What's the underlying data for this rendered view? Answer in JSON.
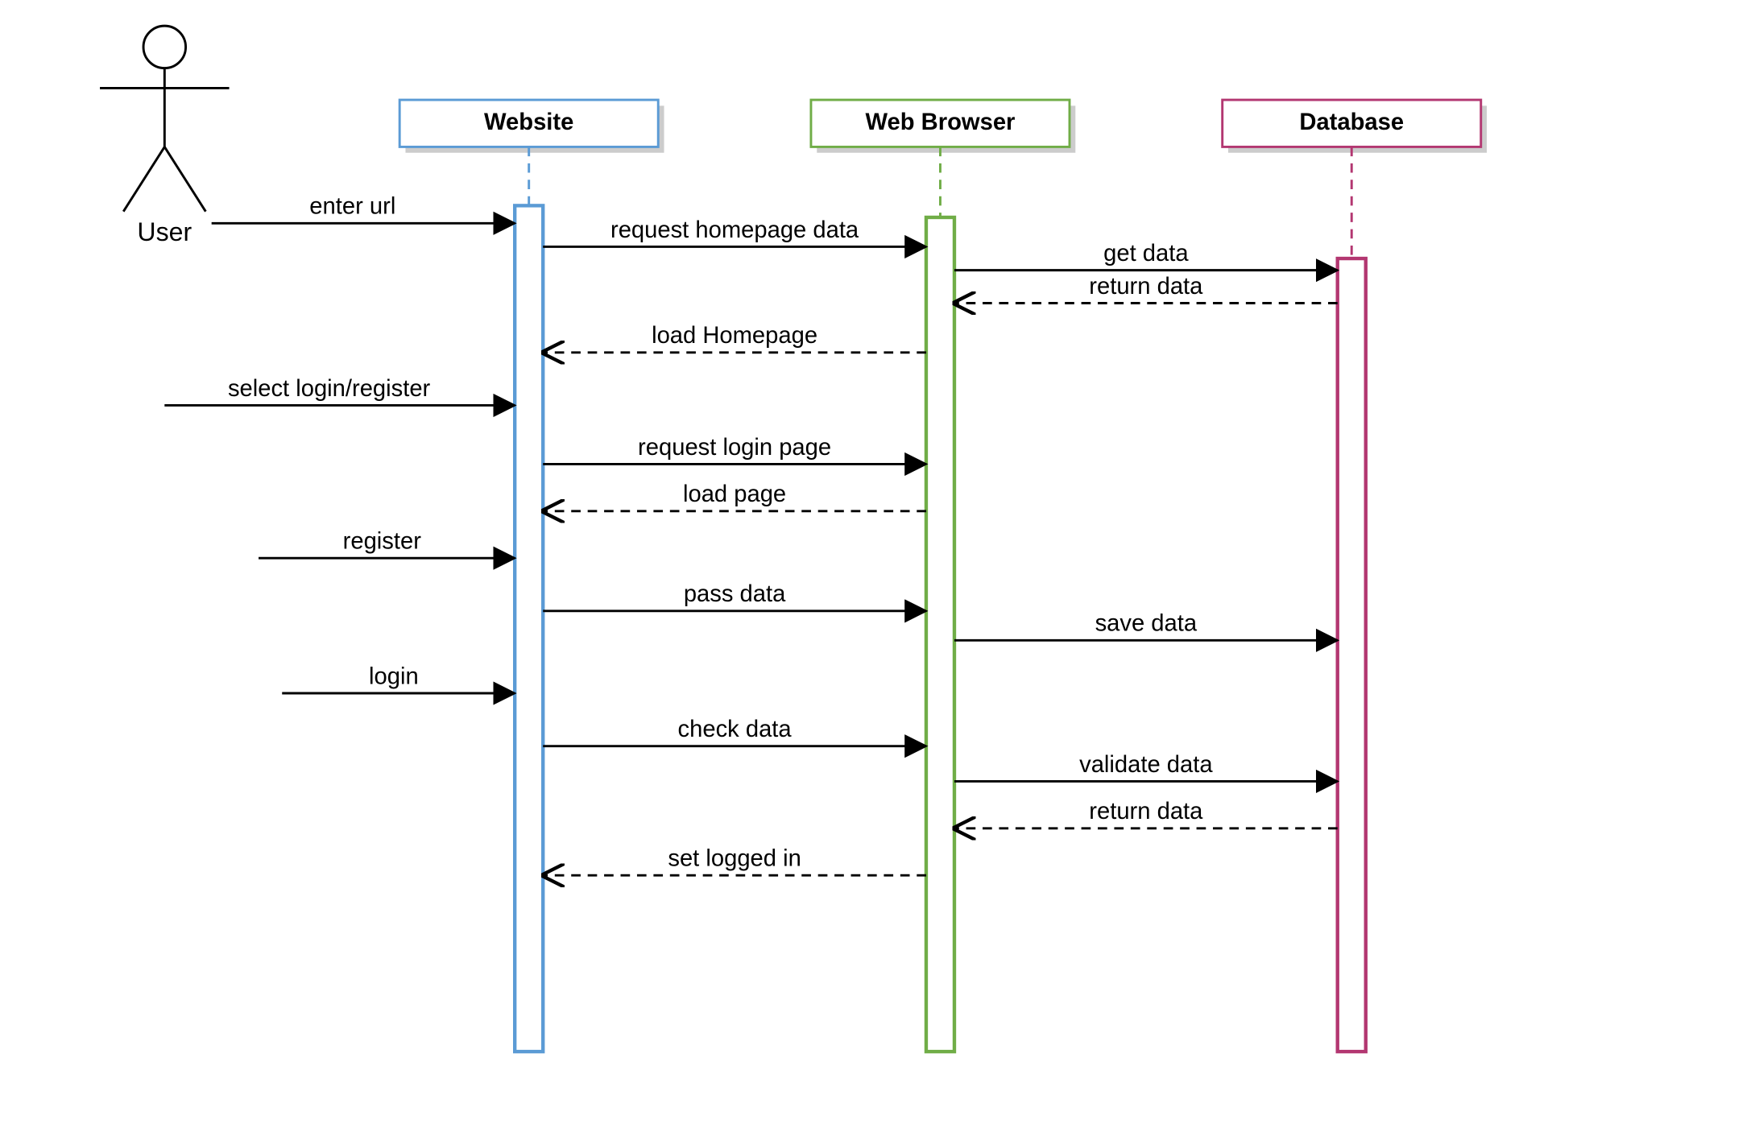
{
  "actor": {
    "name": "User"
  },
  "lifelines": {
    "website": {
      "label": "Website",
      "color": "#5b9bd5"
    },
    "browser": {
      "label": "Web Browser",
      "color": "#70ad47"
    },
    "database": {
      "label": "Database",
      "color": "#b33771"
    }
  },
  "messages": {
    "m1": "enter url",
    "m2": "request homepage data",
    "m3": "get data",
    "m4": "return data",
    "m5": "load Homepage",
    "m6": "select login/register",
    "m7": "request login page",
    "m8": "load page",
    "m9": "register",
    "m10": "pass data",
    "m11": "save data",
    "m12": "login",
    "m13": "check data",
    "m14": "validate data",
    "m15": "return data",
    "m16": "set logged in"
  }
}
